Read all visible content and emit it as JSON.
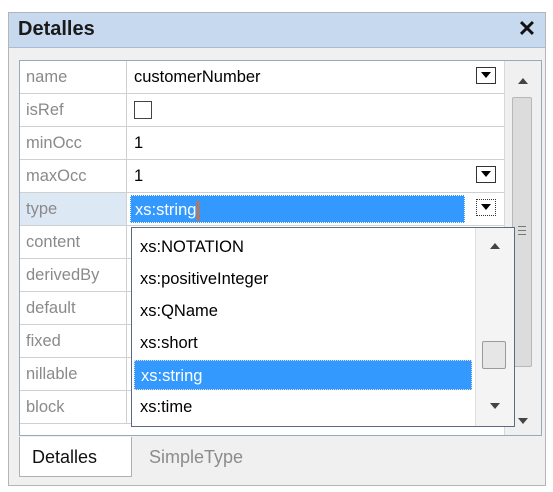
{
  "panel": {
    "title": "Detalles",
    "close_glyph": "✕"
  },
  "properties": [
    {
      "label": "name",
      "value": "customerNumber",
      "control": "dropdown"
    },
    {
      "label": "isRef",
      "value": "",
      "control": "checkbox"
    },
    {
      "label": "minOcc",
      "value": "1",
      "control": "text"
    },
    {
      "label": "maxOcc",
      "value": "1",
      "control": "dropdown"
    },
    {
      "label": "type",
      "value": "xs:string",
      "control": "dropdown",
      "selected": true
    },
    {
      "label": "content",
      "value": "",
      "control": "text"
    },
    {
      "label": "derivedBy",
      "value": "",
      "control": "text"
    },
    {
      "label": "default",
      "value": "",
      "control": "text"
    },
    {
      "label": "fixed",
      "value": "",
      "control": "text"
    },
    {
      "label": "nillable",
      "value": "",
      "control": "text"
    },
    {
      "label": "block",
      "value": "",
      "control": "text"
    }
  ],
  "dropdown_list": {
    "items": [
      "xs:NOTATION",
      "xs:positiveInteger",
      "xs:QName",
      "xs:short",
      "xs:string",
      "xs:time"
    ],
    "selected": "xs:string"
  },
  "tabs": [
    {
      "label": "Detalles",
      "active": true
    },
    {
      "label": "SimpleType",
      "active": false
    }
  ],
  "colors": {
    "titlebar": "#c7d9ef",
    "selection": "#3399ff",
    "label_text": "#8a8a8a"
  }
}
